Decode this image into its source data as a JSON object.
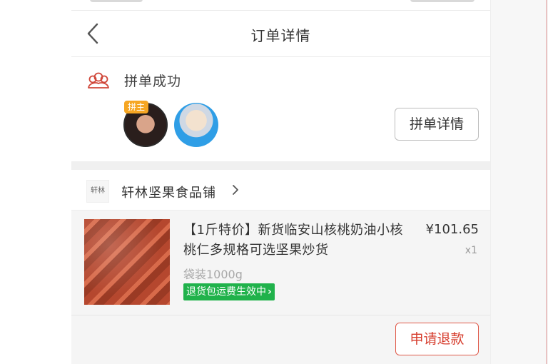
{
  "header": {
    "title": "订单详情"
  },
  "group": {
    "status": "拼单成功",
    "host_badge": "拼主",
    "detail_button": "拼单详情",
    "members": [
      "host-avatar",
      "member-avatar"
    ]
  },
  "shop": {
    "name": "轩林坚果食品铺",
    "logo_text": "轩林"
  },
  "product": {
    "title": "【1斤特价】新货临安山核桃奶油小核桃仁多规格可选坚果炒货",
    "price": "¥101.65",
    "quantity": "x1",
    "spec": "袋装1000g",
    "tag": "退货包运费生效中",
    "refund_button": "申请退款"
  },
  "icons": {
    "back": "chevron-left-icon",
    "group": "group-icon",
    "shop_chevron": "chevron-right-icon"
  },
  "colors": {
    "accent_red": "#d63c2c",
    "tag_green": "#20b24b",
    "host_badge": "#f6a623"
  }
}
